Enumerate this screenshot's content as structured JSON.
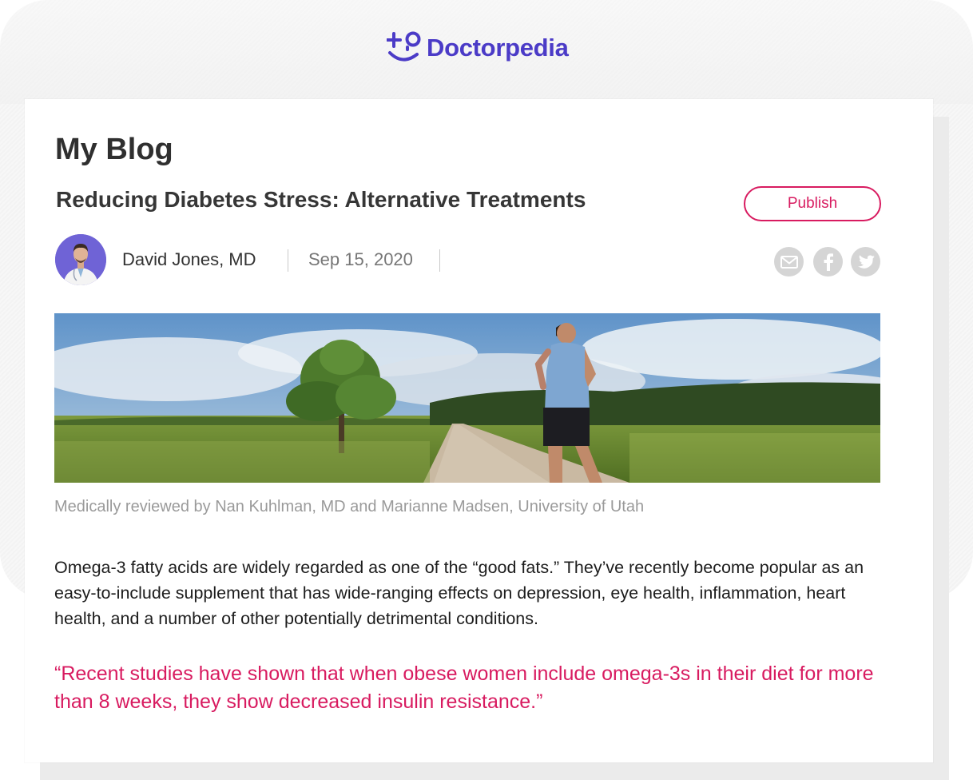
{
  "brand": {
    "name": "Doctorpedia",
    "logo_icon": "plus-smile-logo-icon",
    "color": "#4b3bc7"
  },
  "blog": {
    "title": "My Blog"
  },
  "post": {
    "title": "Reducing Diabetes Stress:  Alternative Treatments",
    "publish_label": "Publish",
    "author": "David Jones, MD",
    "date": "Sep 15, 2020",
    "share": [
      {
        "icon": "mail-icon"
      },
      {
        "icon": "facebook-icon"
      },
      {
        "icon": "twitter-icon"
      }
    ],
    "hero_image": "runner-on-country-road",
    "review_note": "Medically reviewed by Nan Kuhlman, MD and Marianne Madsen, University of Utah",
    "body": "Omega-3 fatty acids are widely regarded as one of the “good fats.” They’ve recently become popular as an easy-to-include supplement that has wide-ranging effects on depression, eye health, inflammation, heart health, and a number of other potentially detrimental conditions.",
    "quote": "“Recent studies have shown that when obese women include omega-3s in their diet for more than 8 weeks, they show decreased insulin resistance.”"
  },
  "colors": {
    "accent": "#d81b60",
    "brand": "#4b3bc7",
    "icon_bg": "#d5d5d5"
  }
}
